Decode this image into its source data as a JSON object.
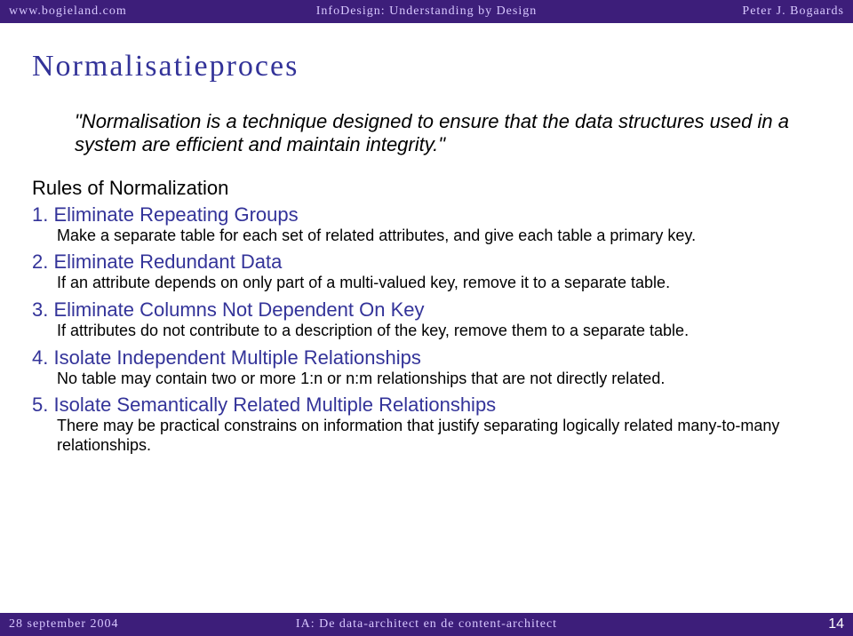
{
  "header": {
    "left": "www.bogieland.com",
    "center": "InfoDesign: Understanding by Design",
    "right": "Peter J. Bogaards"
  },
  "title": "Normalisatieproces",
  "quote": "\"Normalisation is a technique designed to ensure that the data structures used in a system are efficient and maintain integrity.\"",
  "subhead": "Rules of Normalization",
  "rules": [
    {
      "num": "1.",
      "title": "Eliminate Repeating Groups",
      "desc": "Make a separate table for each set of related attributes, and give each table a primary key."
    },
    {
      "num": "2.",
      "title": "Eliminate Redundant Data",
      "desc": "If an attribute depends on only part of a multi-valued key, remove it to a separate table."
    },
    {
      "num": "3.",
      "title": "Eliminate Columns Not Dependent On Key",
      "desc": "If attributes do not contribute to a description of the key, remove them to a separate table."
    },
    {
      "num": "4.",
      "title": "Isolate Independent Multiple Relationships",
      "desc": "No table may contain two or more 1:n or n:m relationships that are not directly related."
    },
    {
      "num": "5.",
      "title": "Isolate Semantically Related Multiple Relationships",
      "desc": "There may be practical constrains on information that justify separating logically related many-to-many relationships."
    }
  ],
  "footer": {
    "left": "28 september 2004",
    "center": "IA: De data-architect en de content-architect",
    "pageno": "14"
  }
}
